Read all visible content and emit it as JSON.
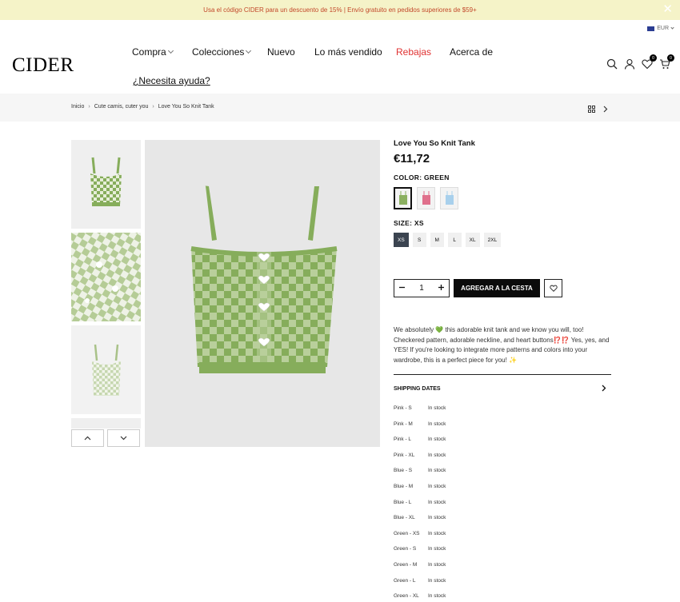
{
  "promo": {
    "text": "Usa el código CIDER para un descuento de 15% | Envío gratuito en pedidos superiores de $59+",
    "close": "✕"
  },
  "currency": {
    "code": "EUR"
  },
  "logo": "CIDER",
  "nav": {
    "items": [
      {
        "label": "Compra",
        "dropdown": true
      },
      {
        "label": "Colecciones",
        "dropdown": true
      },
      {
        "label": "Nuevo",
        "dropdown": false
      },
      {
        "label": "Lo más vendido",
        "dropdown": false
      },
      {
        "label": "Rebajas",
        "dropdown": false
      },
      {
        "label": "Acerca de",
        "dropdown": false
      }
    ],
    "help": "¿Necesita ayuda?"
  },
  "header": {
    "wishlist_count": "0",
    "cart_count": "0"
  },
  "breadcrumb": [
    "Inicio",
    "Cute camis, cuter you",
    "Love You So Knit Tank"
  ],
  "product": {
    "title": "Love You So Knit Tank",
    "price": "€11,72",
    "color_label": "COLOR: GREEN",
    "colors": [
      {
        "name": "green",
        "hex": "#8bb060",
        "active": true
      },
      {
        "name": "pink",
        "hex": "#e0708c",
        "active": false
      },
      {
        "name": "blue",
        "hex": "#a8d0ec",
        "active": false
      }
    ],
    "size_label": "SIZE: XS",
    "sizes": [
      "XS",
      "S",
      "M",
      "L",
      "XL",
      "2XL"
    ],
    "quantity": "1",
    "add_to_cart": "AGREGAR A LA CESTA",
    "description": "We absolutely 💚 this adorable knit tank and we know you will, too! Checkered pattern, adorable neckline, and heart buttons⁉️⁉️ Yes, yes, and YES! If you're looking to integrate more patterns and colors into your wardrobe, this is a perfect piece for you! ✨",
    "shipping_label": "SHIPPING DATES",
    "stock": [
      {
        "variant": "Pink - S",
        "status": "In stock"
      },
      {
        "variant": "Pink - M",
        "status": "In stock"
      },
      {
        "variant": "Pink - L",
        "status": "In stock"
      },
      {
        "variant": "Pink - XL",
        "status": "In stock"
      },
      {
        "variant": "Blue - S",
        "status": "In stock"
      },
      {
        "variant": "Blue - M",
        "status": "In stock"
      },
      {
        "variant": "Blue - L",
        "status": "In stock"
      },
      {
        "variant": "Blue - XL",
        "status": "In stock"
      },
      {
        "variant": "Green - XS",
        "status": "In stock"
      },
      {
        "variant": "Green - S",
        "status": "In stock"
      },
      {
        "variant": "Green - M",
        "status": "In stock"
      },
      {
        "variant": "Green - L",
        "status": "In stock"
      },
      {
        "variant": "Green - XL",
        "status": "In stock"
      }
    ]
  },
  "colors": {
    "accent_green": "#86ad5b",
    "sale_red": "#e03232",
    "promo_bg": "#f5f3c8"
  }
}
